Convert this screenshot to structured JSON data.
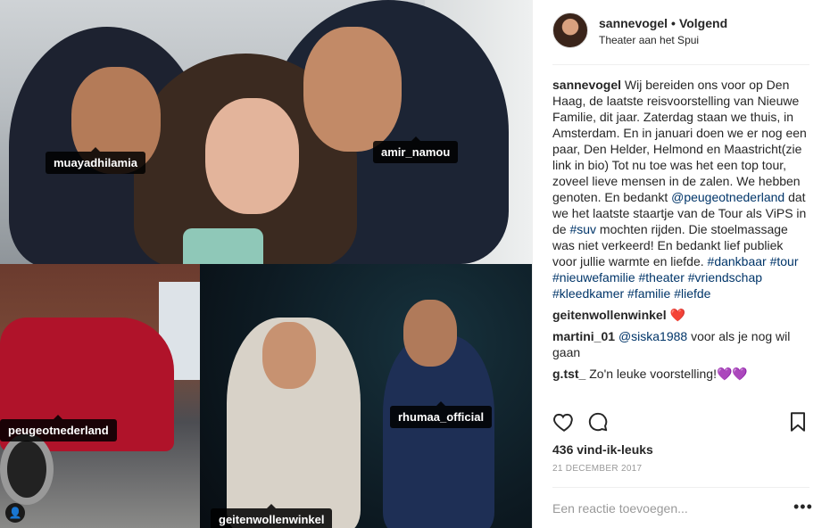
{
  "photo": {
    "tags": [
      {
        "name": "muayadhilamia"
      },
      {
        "name": "amir_namou"
      },
      {
        "name": "peugeotnederland"
      },
      {
        "name": "rhumaa_official"
      },
      {
        "name": "geitenwollenwinkel"
      }
    ]
  },
  "header": {
    "username": "sannevogel",
    "separator": "•",
    "follow_label": "Volgend",
    "location": "Theater aan het Spui"
  },
  "caption": {
    "username": "sannevogel",
    "text_1": " Wij bereiden ons voor op Den Haag, de laatste reisvoorstelling van Nieuwe Familie, dit jaar. Zaterdag staan we thuis, in Amsterdam. En in januari doen we er nog een paar, Den Helder, Helmond en Maastricht(zie link in bio) Tot nu toe was het een top tour, zoveel lieve mensen in de zalen. We hebben genoten. En bedankt ",
    "mention": "@peugeotnederland",
    "text_2": " dat we het laatste staartje van de Tour als ViPS in de ",
    "hashtag_suv": "#suv",
    "text_3": " mochten rijden. Die stoelmassage was niet verkeerd! En bedankt lief publiek voor jullie warmte en liefde. ",
    "hashtags": [
      "#dankbaar",
      "#tour",
      "#nieuwefamilie",
      "#theater",
      "#vriendschap",
      "#kleedkamer",
      "#familie",
      "#liefde"
    ]
  },
  "comments": [
    {
      "username": "geitenwollenwinkel",
      "text": "❤️"
    },
    {
      "username": "martini_01",
      "mention": "@siska1988",
      "text": " voor als je nog wil gaan"
    },
    {
      "username": "g.tst_",
      "text": " Zo'n leuke voorstelling!💜💜"
    }
  ],
  "likes": "436 vind-ik-leuks",
  "date": "21 DECEMBER 2017",
  "add_comment_placeholder": "Een reactie toevoegen...",
  "more_label": "•••",
  "icons": [
    "heart-icon",
    "comment-icon",
    "bookmark-icon",
    "user-tag-icon"
  ],
  "colors": {
    "link": "#003569",
    "muted": "#999999",
    "text": "#262626"
  }
}
